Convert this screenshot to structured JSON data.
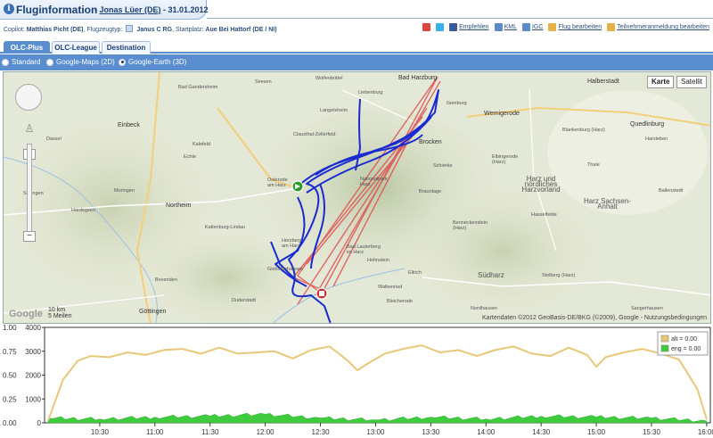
{
  "header": {
    "title": "Fluginformation",
    "pilot": "Jonas Lüer (DE)",
    "date": "31.01.2012"
  },
  "meta": {
    "copilot_label": "Copilot:",
    "copilot": "Matthias Picht (DE)",
    "aircraft_label": "Flugzeugtyp:",
    "aircraft": "Janus C RG",
    "takeoff_label": "Startplatz:",
    "takeoff": "Aue Bei Hattorf (DE / NI)"
  },
  "actions": {
    "recommend": "Empfehlen",
    "kml": "KML",
    "igc": "IGC",
    "edit_flight": "Flug bearbeiten",
    "edit_registration": "Teilnehmeranmeldung bearbeiten"
  },
  "tabs": [
    "OLC-Plus",
    "OLC-League",
    "Destination"
  ],
  "view_options": [
    "Standard",
    "Google-Maps (2D)",
    "Google-Earth (3D)"
  ],
  "map": {
    "btn_map": "Karte",
    "btn_sat": "Satellit",
    "scale_km": "10 km",
    "scale_mi": "5 Meilen",
    "copyright": "Kartendaten ©2012 GeoBasis-DE/BKG (©2009), Google - Nutzungsbedingungen",
    "google": "Google",
    "places": [
      {
        "n": "Bad Harzburg"
      },
      {
        "n": "Ilsenburg"
      },
      {
        "n": "Wernigerode"
      },
      {
        "n": "Halberstadt"
      },
      {
        "n": "Blankenburg (Harz)"
      },
      {
        "n": "Quedlinburg"
      },
      {
        "n": "Clausthal-Zellerfeld"
      },
      {
        "n": "Brocken"
      },
      {
        "n": "Einbeck"
      },
      {
        "n": "Bad Gandersheim"
      },
      {
        "n": "Seesen"
      },
      {
        "n": "Osterode am Harz"
      },
      {
        "n": "Northeim"
      },
      {
        "n": "Dassel"
      },
      {
        "n": "Harz und nördliches Harzvorland"
      },
      {
        "n": "Harz Sachsen-Anhalt"
      },
      {
        "n": "Nationalpark Harz"
      },
      {
        "n": "Bad Lauterberg im Harz"
      },
      {
        "n": "Südharz"
      },
      {
        "n": "Göttingen"
      },
      {
        "n": "Duderstadt"
      },
      {
        "n": "Herzberg am Harz"
      },
      {
        "n": "Nordhausen"
      },
      {
        "n": "Braunlage"
      },
      {
        "n": "Elbingerode (Harz)"
      },
      {
        "n": "Thale"
      },
      {
        "n": "Ballenstedt"
      },
      {
        "n": "Hardegsen"
      },
      {
        "n": "Bovenden"
      },
      {
        "n": "Gieboldehausen"
      },
      {
        "n": "Katlenburg-Lindau"
      },
      {
        "n": "Moringen"
      },
      {
        "n": "Sollingen"
      },
      {
        "n": "Hohnstein"
      },
      {
        "n": "Bleicherode"
      },
      {
        "n": "Sangerhausen"
      },
      {
        "n": "Benneckenstein (Harz)"
      },
      {
        "n": "Stolberg (Harz)"
      },
      {
        "n": "Ellrich"
      },
      {
        "n": "Walkenried"
      },
      {
        "n": "Kalefeld"
      },
      {
        "n": "Echte"
      },
      {
        "n": "Harsleben"
      },
      {
        "n": "Hasselfelde"
      },
      {
        "n": "Schierke"
      },
      {
        "n": "Wolfenbüttel"
      },
      {
        "n": "Langelsheim"
      },
      {
        "n": "Liebenburg"
      }
    ]
  },
  "chart_data": {
    "type": "area",
    "legend": [
      {
        "label": "alt = 0.00",
        "color": "#e8c878"
      },
      {
        "label": "eng = 0.00",
        "color": "#3ecc3e"
      }
    ],
    "left_axis": [
      0.0,
      0.25,
      0.5,
      0.75,
      1.0
    ],
    "right_axis": [
      0,
      1000,
      2000,
      3000,
      4000
    ],
    "x_ticks": [
      "10:30",
      "11:00",
      "11:30",
      "12:00",
      "12:30",
      "13:00",
      "13:30",
      "14:00",
      "14:30",
      "15:00",
      "15:30",
      "16:00"
    ],
    "series": [
      {
        "name": "alt",
        "unit": "m",
        "x": [
          "10:02",
          "10:10",
          "10:18",
          "10:25",
          "10:35",
          "10:45",
          "10:55",
          "11:05",
          "11:15",
          "11:25",
          "11:35",
          "11:45",
          "11:55",
          "12:05",
          "12:15",
          "12:25",
          "12:35",
          "12:45",
          "12:50",
          "12:55",
          "13:05",
          "13:15",
          "13:25",
          "13:35",
          "13:45",
          "13:55",
          "14:05",
          "14:15",
          "14:25",
          "14:35",
          "14:45",
          "14:55",
          "15:00",
          "15:05",
          "15:15",
          "15:25",
          "15:35",
          "15:45",
          "15:55",
          "16:00"
        ],
        "values": [
          100,
          1800,
          2600,
          2800,
          2750,
          2950,
          2850,
          3050,
          3100,
          2900,
          3150,
          2900,
          2950,
          3000,
          2700,
          3050,
          3200,
          2600,
          2200,
          2450,
          2900,
          3100,
          3250,
          2950,
          3050,
          2800,
          3050,
          3200,
          2900,
          2800,
          3150,
          2850,
          2350,
          2750,
          2950,
          3100,
          2900,
          2650,
          1400,
          150
        ]
      },
      {
        "name": "eng",
        "unit": "",
        "x": [
          "10:02",
          "10:30",
          "11:00",
          "11:30",
          "12:00",
          "12:30",
          "13:00",
          "13:30",
          "14:00",
          "14:30",
          "15:00",
          "15:30",
          "16:00"
        ],
        "values": [
          0.05,
          0.04,
          0.06,
          0.07,
          0.09,
          0.05,
          0.03,
          0.06,
          0.04,
          0.07,
          0.06,
          0.05,
          0.02
        ]
      }
    ]
  }
}
